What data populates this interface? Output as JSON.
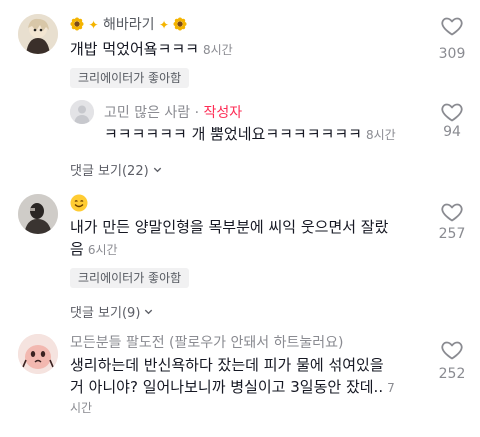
{
  "comments": [
    {
      "username": "해바라기",
      "text": "개밥 먹었어욬ㅋㅋㅋ",
      "time": "8시간",
      "liked_badge": "크리에이터가 좋아함",
      "likes": "309",
      "avatar": "anime-character-avatar"
    },
    {
      "username": "고민 많은 사람",
      "author_tag": "작성자",
      "separator": "·",
      "text": "ㅋㅋㅋㅋㅋㅋ 개 뿜었네요ㅋㅋㅋㅋㅋㅋㅋ",
      "time": "8시간",
      "likes": "94",
      "replies": "댓글 보기(22)",
      "avatar": "default-avatar"
    },
    {
      "username_emoji": "smiling-face-emoji",
      "text_line1": "내가 만든 양말인형을 목부분에 씨익 웃으면서 잘랐",
      "text_line2": "음",
      "time": "6시간",
      "liked_badge": "크리에이터가 좋아함",
      "likes": "257",
      "replies": "댓글 보기(9)",
      "avatar": "dark-photo-avatar"
    },
    {
      "username": "모든분들 팔도전 (팔로우가 안돼서 하트눌러요)",
      "text_line1": "생리하는데 반신욕하다 잤는데 피가 물에 섞여있을",
      "text_line2": "거 아니야? 일어나보니까 병실이고 3일동안 잤데..",
      "time_line1": "7",
      "time_line2": "시간",
      "likes": "252",
      "avatar": "pink-blob-avatar"
    }
  ],
  "colors": {
    "text": "#161823",
    "muted": "#8a8b91",
    "author": "#fe2c55",
    "badge_bg": "#f1f1f2"
  }
}
